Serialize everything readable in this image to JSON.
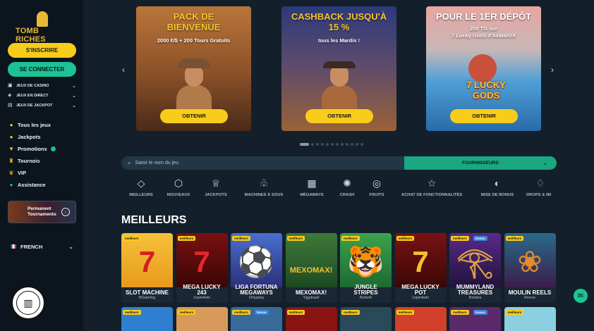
{
  "brand": {
    "logo_text": "TOMB RICHES"
  },
  "sidebar": {
    "signup_label": "S'INSCRIRE",
    "login_label": "SE CONNECTER",
    "categories": [
      {
        "label": "JEUX DE CASINO",
        "icon": "slot-machine-icon"
      },
      {
        "label": "JEUX EN DIRECT",
        "icon": "dice-icon"
      },
      {
        "label": "JEUX DE JACKPOT",
        "icon": "jackpot-icon"
      }
    ],
    "nav": [
      {
        "label": "Tous les jeux",
        "icon": "coins-icon"
      },
      {
        "label": "Jackpots",
        "icon": "moneybag-icon"
      },
      {
        "label": "Promotions",
        "icon": "gift-icon"
      },
      {
        "label": "Tournois",
        "icon": "trophy-icon"
      },
      {
        "label": "VIP",
        "icon": "crown-icon"
      },
      {
        "label": "Assistance",
        "icon": "chat-icon"
      }
    ],
    "tournament_card": {
      "line1": "Permanent",
      "line2": "Tournaments"
    },
    "language": "FRENCH",
    "seal_text": "SOCIÉTÉ DE BONUS"
  },
  "promos": [
    {
      "title_line1": "PACK DE",
      "title_line2": "BIENVENUE",
      "sub_line1": "2000 €/$ + 200 Tours Gratuits",
      "sub_line2": "",
      "button": "OBTENIR"
    },
    {
      "title_line1": "CASHBACK JUSQU'À",
      "title_line2": "15 %",
      "sub_line1": "tous les Mardis !",
      "sub_line2": "",
      "button": "OBTENIR"
    },
    {
      "title_line1": "POUR LE 1ER DÉPÔT",
      "title_line2": "",
      "sub_line1": "200 TG sur",
      "sub_line2": "7 Lucky Gods d'AvatarUX",
      "button": "OBTENIR",
      "art_text": "7 LUCKY GODS"
    }
  ],
  "carousel": {
    "dot_count": 12,
    "active_index": 0
  },
  "search": {
    "placeholder": "Saisir le nom du jeu"
  },
  "providers": {
    "label": "FOURNISSEURS"
  },
  "game_categories": [
    {
      "label": "MEILLEURS",
      "icon": "diamond-icon"
    },
    {
      "label": "NOUVEAUX",
      "icon": "cube-icon"
    },
    {
      "label": "JACKPOTS",
      "icon": "crown-icon"
    },
    {
      "label": "MACHINES À SOUS",
      "icon": "cherries-icon"
    },
    {
      "label": "MÉGAWAYS",
      "icon": "slot-icon"
    },
    {
      "label": "CRASH",
      "icon": "bomb-icon"
    },
    {
      "label": "FRUITS",
      "icon": "fruit-icon"
    },
    {
      "label": "ACHAT DE FONCTIONNALITÉS",
      "icon": "star-icon"
    },
    {
      "label": "MISE DE BONUS",
      "icon": "bonus-icon"
    },
    {
      "label": "DROPS & WI",
      "icon": "drops-icon"
    }
  ],
  "section_title": "MEILLEURS",
  "games": [
    {
      "name_line1": "SLOT MACHINE",
      "name_line2": "",
      "provider": "BGaming",
      "badge": "meilleurs",
      "badge2": ""
    },
    {
      "name_line1": "MEGA LUCKY",
      "name_line2": "243",
      "provider": "1spin4win",
      "badge": "meilleurs",
      "badge2": ""
    },
    {
      "name_line1": "LIGA FORTUNA",
      "name_line2": "MEGAWAYS",
      "provider": "Onlyplay",
      "badge": "meilleurs",
      "badge2": ""
    },
    {
      "name_line1": "MEXOMAX!",
      "name_line2": "",
      "provider": "Yggdrasil",
      "badge": "meilleurs",
      "badge2": "",
      "art_text": "MEXOMAX!"
    },
    {
      "name_line1": "JUNGLE",
      "name_line2": "STRIPES",
      "provider": "Betsoft",
      "badge": "meilleurs",
      "badge2": ""
    },
    {
      "name_line1": "MEGA LUCKY",
      "name_line2": "POT",
      "provider": "1spin4win",
      "badge": "meilleurs",
      "badge2": ""
    },
    {
      "name_line1": "MUMMYLAND",
      "name_line2": "TREASURES",
      "provider": "Belatra",
      "badge": "meilleurs",
      "badge2": "bonus"
    },
    {
      "name_line1": "MOULIN REELS",
      "name_line2": "",
      "provider": "Reevo",
      "badge": "meilleurs",
      "badge2": ""
    }
  ],
  "next_row_badges": [
    {
      "badge": "meilleurs",
      "badge2": ""
    },
    {
      "badge": "meilleurs",
      "badge2": ""
    },
    {
      "badge": "meilleurs",
      "badge2": "bonus"
    },
    {
      "badge": "meilleurs",
      "badge2": ""
    },
    {
      "badge": "meilleurs",
      "badge2": ""
    },
    {
      "badge": "meilleurs",
      "badge2": ""
    },
    {
      "badge": "meilleurs",
      "badge2": "bonus"
    },
    {
      "badge": "meilleurs",
      "badge2": ""
    }
  ],
  "colors": {
    "yellow": "#f8cc1b",
    "green": "#1dc295",
    "background": "#13202c",
    "sidebar": "#0c151e"
  }
}
